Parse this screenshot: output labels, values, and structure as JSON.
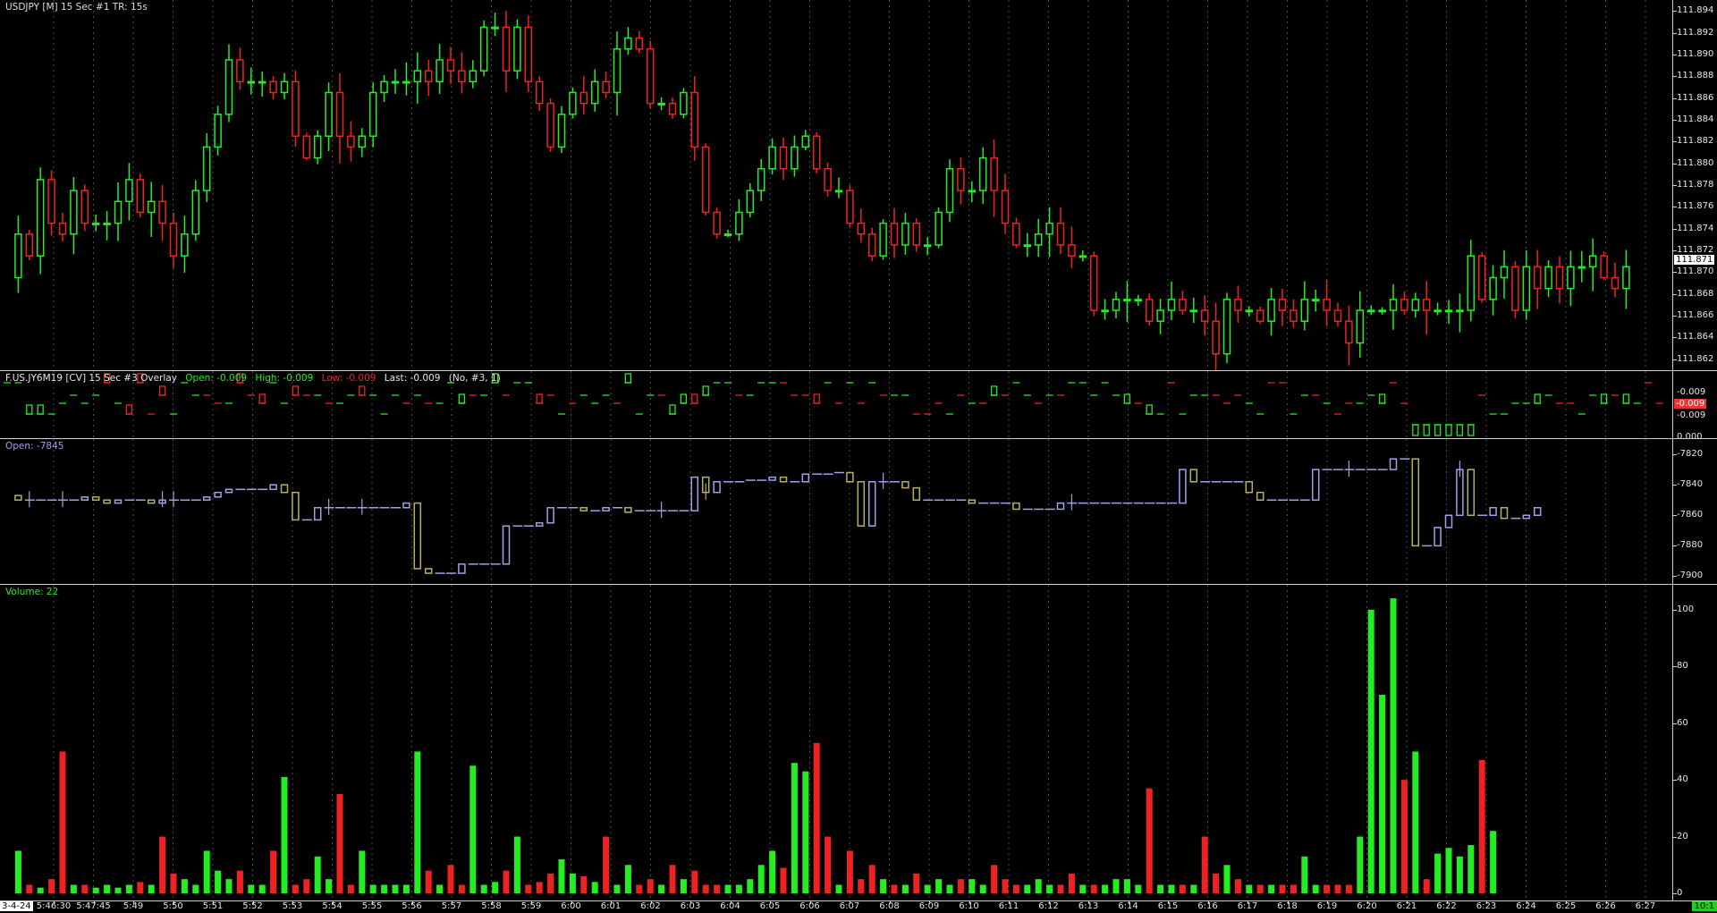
{
  "colors": {
    "up": "#22ee22",
    "down": "#ee2222",
    "purple": "#9fa0e8",
    "olive": "#b8b060",
    "text": "#e6e6e6"
  },
  "pane1": {
    "legend": "USDJPY [M]  15 Sec  #1 TR: 15s",
    "price_tag": "111.871",
    "ylim": [
      111.861,
      111.895
    ],
    "ticks": [
      "111.862",
      "111.864",
      "111.866",
      "111.868",
      "111.870",
      "111.872",
      "111.874",
      "111.876",
      "111.878",
      "111.880",
      "111.882",
      "111.884",
      "111.886",
      "111.888",
      "111.890",
      "111.892",
      "111.894"
    ],
    "tick_values": [
      111.862,
      111.864,
      111.866,
      111.868,
      111.87,
      111.872,
      111.874,
      111.876,
      111.878,
      111.88,
      111.882,
      111.884,
      111.886,
      111.888,
      111.89,
      111.892,
      111.894
    ],
    "path": [
      111.8695,
      111.8735,
      111.8715,
      111.8785,
      111.8745,
      111.8735,
      111.8775,
      111.8745,
      111.8745,
      111.8745,
      111.8765,
      111.8785,
      111.8755,
      111.8765,
      111.8745,
      111.8715,
      111.8735,
      111.8775,
      111.8815,
      111.8845,
      111.8895,
      111.8875,
      111.8875,
      111.8875,
      111.8865,
      111.8875,
      111.8825,
      111.8805,
      111.8825,
      111.8865,
      111.8825,
      111.8815,
      111.8825,
      111.8865,
      111.8875,
      111.8875,
      111.8875,
      111.8885,
      111.8875,
      111.8895,
      111.8885,
      111.8875,
      111.8885,
      111.8925,
      111.8925,
      111.8885,
      111.8925,
      111.8875,
      111.8855,
      111.8815,
      111.8845,
      111.8865,
      111.8855,
      111.8875,
      111.8865,
      111.8905,
      111.8915,
      111.8905,
      111.8855,
      111.8855,
      111.8845,
      111.8865,
      111.8815,
      111.8755,
      111.8735,
      111.8735,
      111.8755,
      111.8775,
      111.8795,
      111.8815,
      111.8795,
      111.8815,
      111.8825,
      111.8795,
      111.8775,
      111.8775,
      111.8745,
      111.8735,
      111.8715,
      111.8745,
      111.8725,
      111.8745,
      111.8725,
      111.8725,
      111.8755,
      111.8795,
      111.8775,
      111.8775,
      111.8805,
      111.8775,
      111.8745,
      111.8725,
      111.8725,
      111.8735,
      111.8745,
      111.8725,
      111.8715,
      111.8715,
      111.8665,
      111.8665,
      111.8675,
      111.8675,
      111.8675,
      111.8655,
      111.8665,
      111.8675,
      111.8665,
      111.8665,
      111.8655,
      111.8625,
      111.8675,
      111.8665,
      111.8665,
      111.8655,
      111.8675,
      111.8665,
      111.8655,
      111.8675,
      111.8675,
      111.8665,
      111.8655,
      111.8635,
      111.8665,
      111.8665,
      111.8665,
      111.8675,
      111.8665,
      111.8675,
      111.8665,
      111.8665,
      111.8665,
      111.8665,
      111.8715,
      111.8675,
      111.8695,
      111.8705,
      111.8665,
      111.8705,
      111.8685,
      111.8705,
      111.8685,
      111.8705,
      111.8705,
      111.8715,
      111.8695,
      111.8685,
      111.8705
    ]
  },
  "pane2": {
    "legend_name": "F.US.JY6M19 [CV]  15 Sec  #3 Overlay",
    "legend_open": "Open: -0.009",
    "legend_high": "High: -0.009",
    "legend_low": "Low: -0.009",
    "legend_last": "Last: -0.009",
    "legend_params": "(No, #3, 1)",
    "price_tag": "-0.009",
    "ticks": [
      "-0.009",
      "-0.009",
      "0.000"
    ]
  },
  "pane3": {
    "legend": "Open: -7845",
    "ylim": [
      -7905,
      -7810
    ],
    "ticks": [
      "-7820",
      "-7840",
      "-7860",
      "-7880",
      "-7900"
    ],
    "tick_values": [
      -7820,
      -7840,
      -7860,
      -7880,
      -7900
    ],
    "path": [
      -7847,
      -7850,
      -7850,
      -7850,
      -7850,
      -7850,
      -7850,
      -7848,
      -7850,
      -7852,
      -7850,
      -7850,
      -7850,
      -7852,
      -7850,
      -7850,
      -7850,
      -7850,
      -7848,
      -7845,
      -7843,
      -7843,
      -7843,
      -7843,
      -7840,
      -7845,
      -7863,
      -7863,
      -7855,
      -7855,
      -7855,
      -7855,
      -7855,
      -7855,
      -7855,
      -7855,
      -7852,
      -7895,
      -7898,
      -7898,
      -7898,
      -7892,
      -7892,
      -7892,
      -7892,
      -7867,
      -7867,
      -7867,
      -7865,
      -7855,
      -7855,
      -7855,
      -7857,
      -7857,
      -7855,
      -7855,
      -7858,
      -7857,
      -7857,
      -7857,
      -7857,
      -7857,
      -7835,
      -7845,
      -7838,
      -7838,
      -7838,
      -7837,
      -7837,
      -7835,
      -7838,
      -7838,
      -7833,
      -7833,
      -7833,
      -7832,
      -7838,
      -7867,
      -7838,
      -7838,
      -7838,
      -7842,
      -7850,
      -7850,
      -7850,
      -7850,
      -7850,
      -7852,
      -7852,
      -7852,
      -7852,
      -7856,
      -7856,
      -7856,
      -7856,
      -7852,
      -7852,
      -7852,
      -7852,
      -7852,
      -7852,
      -7852,
      -7852,
      -7852,
      -7852,
      -7852,
      -7830,
      -7838,
      -7838,
      -7838,
      -7838,
      -7838,
      -7845,
      -7850,
      -7850,
      -7850,
      -7850,
      -7850,
      -7830,
      -7830,
      -7830,
      -7830,
      -7830,
      -7830,
      -7830,
      -7823,
      -7823,
      -7880,
      -7880,
      -7868,
      -7860,
      -7830,
      -7860,
      -7860,
      -7855,
      -7862,
      -7862,
      -7860,
      -7855
    ]
  },
  "pane4": {
    "legend": "Volume: 22",
    "ylim": [
      0,
      105
    ],
    "ticks": [
      "100",
      "80",
      "60",
      "40",
      "20",
      "0"
    ],
    "tick_values": [
      100,
      80,
      60,
      40,
      20,
      0
    ],
    "values": [
      15,
      3,
      2,
      5,
      50,
      3,
      3,
      2,
      3,
      2,
      3,
      4,
      3,
      20,
      7,
      5,
      3,
      15,
      8,
      5,
      8,
      3,
      3,
      15,
      41,
      3,
      5,
      13,
      5,
      35,
      3,
      15,
      3,
      3,
      3,
      3,
      50,
      8,
      3,
      10,
      3,
      45,
      3,
      4,
      8,
      20,
      3,
      4,
      7,
      12,
      7,
      6,
      4,
      20,
      3,
      10,
      3,
      5,
      3,
      10,
      5,
      8,
      3,
      3,
      3,
      3,
      5,
      10,
      15,
      9,
      46,
      43,
      53,
      20,
      3,
      15,
      5,
      10,
      5,
      3,
      3,
      7,
      3,
      5,
      3,
      5,
      5,
      3,
      10,
      5,
      3,
      3,
      5,
      3,
      3,
      7,
      3,
      3,
      3,
      5,
      5,
      3,
      37,
      3,
      3,
      3,
      3,
      20,
      7,
      10,
      5,
      3,
      3,
      3,
      3,
      3,
      13,
      3,
      3,
      3,
      3,
      20,
      100,
      70,
      104,
      40,
      50,
      5,
      14,
      16,
      13,
      17,
      47,
      22
    ]
  },
  "time_axis": {
    "left_tag": "3-4-24",
    "right_tag": "10:1",
    "labels": [
      "5:46:30",
      "5:47:45",
      "5:49",
      "5:50",
      "5:51",
      "5:52",
      "5:53",
      "5:54",
      "5:55",
      "5:56",
      "5:57",
      "5:58",
      "5:59",
      "6:00",
      "6:01",
      "6:02",
      "6:03",
      "6:04",
      "6:05",
      "6:06",
      "6:07",
      "6:08",
      "6:09",
      "6:10",
      "6:11",
      "6:12",
      "6:13",
      "6:14",
      "6:15",
      "6:16",
      "6:17",
      "6:18",
      "6:19",
      "6:20",
      "6:21",
      "6:22",
      "6:23",
      "6:24",
      "6:25",
      "6:26",
      "6:27"
    ]
  }
}
